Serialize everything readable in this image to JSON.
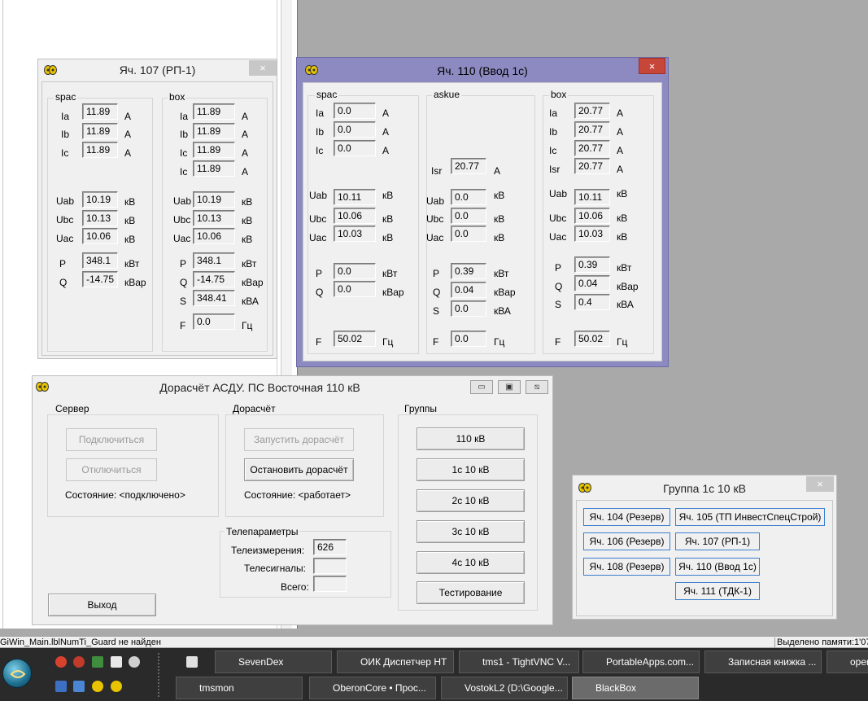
{
  "colors": {
    "active_frame": "#8d8ac2",
    "close_red": "#c7463a",
    "taskbar": "#2a2a2a",
    "desktop": "#a9a9a9"
  },
  "w107": {
    "title": "Яч. 107 (РП-1)",
    "close": "×",
    "spac": {
      "legend": "spac",
      "ia": {
        "label": "Ia",
        "value": "11.89",
        "unit": "A"
      },
      "ib": {
        "label": "Ib",
        "value": "11.89",
        "unit": "A"
      },
      "ic": {
        "label": "Ic",
        "value": "11.89",
        "unit": "A"
      },
      "uab": {
        "label": "Uab",
        "value": "10.19",
        "unit": "кВ"
      },
      "ubc": {
        "label": "Ubc",
        "value": "10.13",
        "unit": "кВ"
      },
      "uac": {
        "label": "Uac",
        "value": "10.06",
        "unit": "кВ"
      },
      "p": {
        "label": "P",
        "value": "348.1",
        "unit": "кВт"
      },
      "q": {
        "label": "Q",
        "value": "-14.75",
        "unit": "кВар"
      }
    },
    "box": {
      "legend": "box",
      "ia": {
        "label": "Ia",
        "value": "11.89",
        "unit": "A"
      },
      "ib": {
        "label": "Ib",
        "value": "11.89",
        "unit": "A"
      },
      "ic": {
        "label": "Ic",
        "value": "11.89",
        "unit": "A"
      },
      "ic2": {
        "label": "Ic",
        "value": "11.89",
        "unit": "A"
      },
      "uab": {
        "label": "Uab",
        "value": "10.19",
        "unit": "кВ"
      },
      "ubc": {
        "label": "Ubc",
        "value": "10.13",
        "unit": "кВ"
      },
      "uac": {
        "label": "Uac",
        "value": "10.06",
        "unit": "кВ"
      },
      "p": {
        "label": "P",
        "value": "348.1",
        "unit": "кВт"
      },
      "q": {
        "label": "Q",
        "value": "-14.75",
        "unit": "кВар"
      },
      "s": {
        "label": "S",
        "value": "348.41",
        "unit": "кВА"
      },
      "f": {
        "label": "F",
        "value": "0.0",
        "unit": "Гц"
      }
    }
  },
  "w110": {
    "title": "Яч. 110 (Ввод 1с)",
    "close": "×",
    "spac": {
      "legend": "spac",
      "ia": {
        "label": "Ia",
        "value": "0.0",
        "unit": "A"
      },
      "ib": {
        "label": "Ib",
        "value": "0.0",
        "unit": "A"
      },
      "ic": {
        "label": "Ic",
        "value": "0.0",
        "unit": "A"
      },
      "uab": {
        "label": "Uab",
        "value": "10.11",
        "unit": "кВ"
      },
      "ubc": {
        "label": "Ubc",
        "value": "10.06",
        "unit": "кВ"
      },
      "uac": {
        "label": "Uac",
        "value": "10.03",
        "unit": "кВ"
      },
      "p": {
        "label": "P",
        "value": "0.0",
        "unit": "кВт"
      },
      "q": {
        "label": "Q",
        "value": "0.0",
        "unit": "кВар"
      },
      "f": {
        "label": "F",
        "value": "50.02",
        "unit": "Гц"
      }
    },
    "askue": {
      "legend": "askue",
      "isr": {
        "label": "Isr",
        "value": "20.77",
        "unit": "A"
      },
      "uab": {
        "label": "Uab",
        "value": "0.0",
        "unit": "кВ"
      },
      "ubc": {
        "label": "Ubc",
        "value": "0.0",
        "unit": "кВ"
      },
      "uac": {
        "label": "Uac",
        "value": "0.0",
        "unit": "кВ"
      },
      "p": {
        "label": "P",
        "value": "0.39",
        "unit": "кВт"
      },
      "q": {
        "label": "Q",
        "value": "0.04",
        "unit": "кВар"
      },
      "s": {
        "label": "S",
        "value": "0.0",
        "unit": "кВА"
      },
      "f": {
        "label": "F",
        "value": "0.0",
        "unit": "Гц"
      }
    },
    "box": {
      "legend": "box",
      "ia": {
        "label": "Ia",
        "value": "20.77",
        "unit": "A"
      },
      "ib": {
        "label": "Ib",
        "value": "20.77",
        "unit": "A"
      },
      "ic": {
        "label": "Ic",
        "value": "20.77",
        "unit": "A"
      },
      "isr": {
        "label": "Isr",
        "value": "20.77",
        "unit": "A"
      },
      "uab": {
        "label": "Uab",
        "value": "10.11",
        "unit": "кВ"
      },
      "ubc": {
        "label": "Ubc",
        "value": "10.06",
        "unit": "кВ"
      },
      "uac": {
        "label": "Uac",
        "value": "10.03",
        "unit": "кВ"
      },
      "p": {
        "label": "P",
        "value": "0.39",
        "unit": "кВт"
      },
      "q": {
        "label": "Q",
        "value": "0.04",
        "unit": "кВар"
      },
      "s": {
        "label": "S",
        "value": "0.4",
        "unit": "кВА"
      },
      "f": {
        "label": "F",
        "value": "50.02",
        "unit": "Гц"
      }
    }
  },
  "main": {
    "title": "Дорасчёт АСДУ. ПС Восточная 110 кВ",
    "ctl_min": "▭",
    "ctl_max": "▣",
    "ctl_close": "⧅",
    "server": {
      "legend": "Сервер",
      "connect": "Подключиться",
      "disconnect": "Отключиться",
      "status": "Состояние: <подключено>"
    },
    "calc": {
      "legend": "Дорасчёт",
      "start": "Запустить дорасчёт",
      "stop": "Остановить дорасчёт",
      "status": "Состояние: <работает>"
    },
    "tele": {
      "legend": "Телепараметры",
      "meas_label": "Телеизмерения:",
      "meas_value": "626",
      "sig_label": "Телесигналы:",
      "sig_value": "",
      "total_label": "Всего:",
      "total_value": ""
    },
    "groups": {
      "legend": "Группы",
      "items": [
        "110 кВ",
        "1с 10 кВ",
        "2с 10 кВ",
        "3с 10 кВ",
        "4с 10 кВ",
        "Тестирование"
      ]
    },
    "exit": "Выход"
  },
  "group1c": {
    "title": "Группа 1с 10 кВ",
    "close": "×",
    "cells": [
      "Яч. 104 (Резерв)",
      "Яч. 105 (ТП ИнвестСпецСтрой)",
      "Яч. 106 (Резерв)",
      "Яч. 107 (РП-1)",
      "Яч. 108 (Резерв)",
      "Яч. 110 (Ввод 1с)",
      "Яч. 111 (ТДК-1)"
    ]
  },
  "statusbar": {
    "left": "GiWin_Main.lblNumTi_Guard не найден",
    "right": "Выделено памяти:1'07"
  },
  "taskbar": {
    "row1": [
      "SevenDex",
      "ОИК Диспетчер НТ",
      "tms1 - TightVNC V...",
      "PortableApps.com...",
      "Записная книжка ...",
      "oper"
    ],
    "row2": [
      "tmsmon",
      "OberonCore • Прос...",
      "VostokL2 (D:\\Google...",
      "BlackBox"
    ]
  }
}
